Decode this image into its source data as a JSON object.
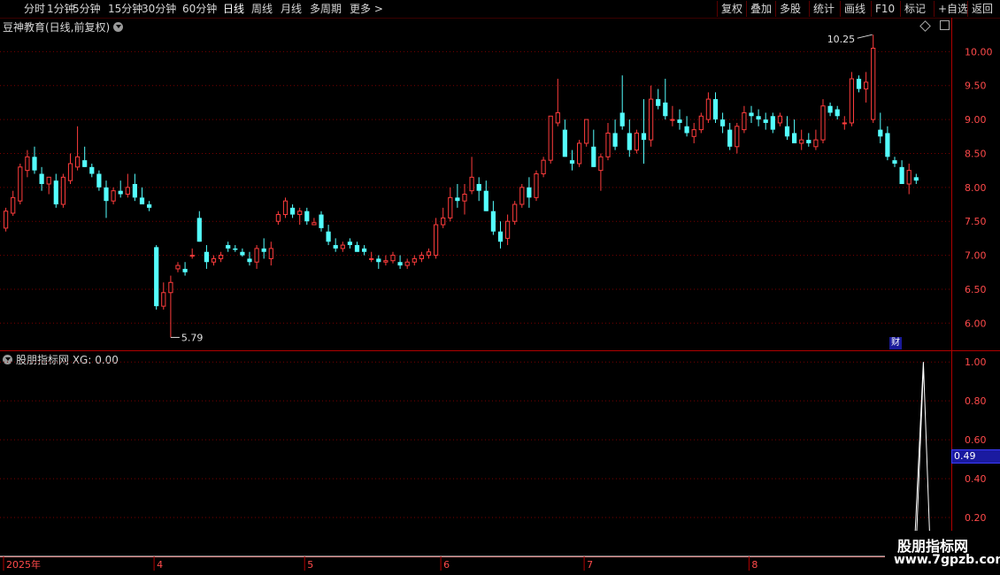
{
  "toolbar": {
    "left": [
      {
        "label": "分时"
      },
      {
        "label": "1分钟"
      },
      {
        "label": "5分钟"
      },
      {
        "label": "15分钟"
      },
      {
        "label": "30分钟"
      },
      {
        "label": "60分钟"
      },
      {
        "label": "日线",
        "active": true
      },
      {
        "label": "周线"
      },
      {
        "label": "月线"
      },
      {
        "label": "多周期"
      },
      {
        "label": "更多 >"
      }
    ],
    "right": [
      {
        "label": "复权"
      },
      {
        "label": "叠加"
      },
      {
        "label": "多股"
      },
      {
        "label": "统计"
      },
      {
        "label": "画线"
      },
      {
        "label": "F10"
      },
      {
        "label": "标记"
      },
      {
        "label": "+自选"
      },
      {
        "label": "返回"
      }
    ]
  },
  "main_title": "豆神教育(日线,前复权)",
  "indicator_title": "股朋指标网 XG: 0.00",
  "cai_label": "财",
  "high_label": "10.25",
  "low_label": "5.79",
  "current_indicator_value": "0.49",
  "watermark": {
    "line1": "股朋指标网",
    "line2": "www.7gpzb.com"
  },
  "colors": {
    "up": "#ff3c3c",
    "down": "#54ffff",
    "grid": "#7a0000",
    "axis": "#ff4a4a",
    "bg": "#000000"
  },
  "chart_data": [
    {
      "type": "candlestick",
      "title": "豆神教育(日线,前复权)",
      "ylim": [
        5.6,
        10.5
      ],
      "y_ticks": [
        "10.00",
        "9.50",
        "9.00",
        "8.50",
        "8.00",
        "7.50",
        "7.00",
        "6.50",
        "6.00"
      ],
      "x_date_labels": [
        {
          "label": "2025年",
          "index": 0
        },
        {
          "label": "4",
          "index": 21
        },
        {
          "label": "5",
          "index": 42
        },
        {
          "label": "6",
          "index": 61
        },
        {
          "label": "7",
          "index": 81
        },
        {
          "label": "8",
          "index": 104
        }
      ],
      "ohlc": [
        [
          7.4,
          7.7,
          7.35,
          7.65
        ],
        [
          7.62,
          7.95,
          7.58,
          7.85
        ],
        [
          7.8,
          8.35,
          7.75,
          8.3
        ],
        [
          8.25,
          8.55,
          8.15,
          8.45
        ],
        [
          8.45,
          8.6,
          8.2,
          8.25
        ],
        [
          8.2,
          8.3,
          7.95,
          8.05
        ],
        [
          8.05,
          8.15,
          7.9,
          8.15
        ],
        [
          8.1,
          8.2,
          7.7,
          7.75
        ],
        [
          7.75,
          8.2,
          7.7,
          8.15
        ],
        [
          8.1,
          8.5,
          8.05,
          8.35
        ],
        [
          8.3,
          8.9,
          8.25,
          8.45
        ],
        [
          8.4,
          8.6,
          8.3,
          8.3
        ],
        [
          8.3,
          8.35,
          8.15,
          8.2
        ],
        [
          8.2,
          8.25,
          7.95,
          8.0
        ],
        [
          8.0,
          8.1,
          7.55,
          7.8
        ],
        [
          7.8,
          8.0,
          7.75,
          7.95
        ],
        [
          7.95,
          8.1,
          7.85,
          7.9
        ],
        [
          7.9,
          8.2,
          7.85,
          8.0
        ],
        [
          8.05,
          8.2,
          7.8,
          7.85
        ],
        [
          7.85,
          8.0,
          7.75,
          7.75
        ],
        [
          7.75,
          7.8,
          7.65,
          7.7
        ],
        [
          7.12,
          7.15,
          6.2,
          6.25
        ],
        [
          6.25,
          6.6,
          6.2,
          6.45
        ],
        [
          6.45,
          6.7,
          5.79,
          6.6
        ],
        [
          6.8,
          6.9,
          6.75,
          6.85
        ],
        [
          6.8,
          6.9,
          6.7,
          6.75
        ],
        [
          7.0,
          7.1,
          6.95,
          7.0
        ],
        [
          7.55,
          7.65,
          7.2,
          7.2
        ],
        [
          7.05,
          7.15,
          6.8,
          6.9
        ],
        [
          6.9,
          7.0,
          6.85,
          6.95
        ],
        [
          6.95,
          7.05,
          6.9,
          7.0
        ],
        [
          7.15,
          7.2,
          7.05,
          7.1
        ],
        [
          7.1,
          7.15,
          7.05,
          7.08
        ],
        [
          7.05,
          7.1,
          6.98,
          7.0
        ],
        [
          6.95,
          7.05,
          6.85,
          6.9
        ],
        [
          6.9,
          7.15,
          6.8,
          7.1
        ],
        [
          7.1,
          7.25,
          6.95,
          7.05
        ],
        [
          6.95,
          7.2,
          6.85,
          7.1
        ],
        [
          7.5,
          7.65,
          7.45,
          7.6
        ],
        [
          7.6,
          7.85,
          7.55,
          7.8
        ],
        [
          7.7,
          7.75,
          7.55,
          7.6
        ],
        [
          7.6,
          7.7,
          7.45,
          7.65
        ],
        [
          7.65,
          7.7,
          7.45,
          7.5
        ],
        [
          7.45,
          7.55,
          7.45,
          7.48
        ],
        [
          7.6,
          7.65,
          7.35,
          7.4
        ],
        [
          7.35,
          7.45,
          7.15,
          7.2
        ],
        [
          7.15,
          7.25,
          7.05,
          7.1
        ],
        [
          7.1,
          7.2,
          7.05,
          7.15
        ],
        [
          7.2,
          7.25,
          7.1,
          7.15
        ],
        [
          7.15,
          7.2,
          7.05,
          7.05
        ],
        [
          7.1,
          7.15,
          7.0,
          7.05
        ],
        [
          6.95,
          7.05,
          6.9,
          6.95
        ],
        [
          6.95,
          7.0,
          6.8,
          6.9
        ],
        [
          6.9,
          7.0,
          6.85,
          6.92
        ],
        [
          6.92,
          7.05,
          6.88,
          7.0
        ],
        [
          6.9,
          7.0,
          6.8,
          6.85
        ],
        [
          6.85,
          6.95,
          6.8,
          6.9
        ],
        [
          6.9,
          7.0,
          6.85,
          6.95
        ],
        [
          6.95,
          7.05,
          6.9,
          7.0
        ],
        [
          7.0,
          7.1,
          6.95,
          7.05
        ],
        [
          7.0,
          7.55,
          6.95,
          7.45
        ],
        [
          7.45,
          7.7,
          7.4,
          7.55
        ],
        [
          7.55,
          8.0,
          7.5,
          7.85
        ],
        [
          7.85,
          8.05,
          7.7,
          7.8
        ],
        [
          7.8,
          8.05,
          7.6,
          7.9
        ],
        [
          7.95,
          8.45,
          7.9,
          8.15
        ],
        [
          8.05,
          8.15,
          7.8,
          7.95
        ],
        [
          7.95,
          8.1,
          7.65,
          7.65
        ],
        [
          7.65,
          7.8,
          7.3,
          7.35
        ],
        [
          7.35,
          7.5,
          7.1,
          7.2
        ],
        [
          7.25,
          7.6,
          7.15,
          7.5
        ],
        [
          7.5,
          7.8,
          7.45,
          7.75
        ],
        [
          7.75,
          8.05,
          7.7,
          8.0
        ],
        [
          8.0,
          8.15,
          7.7,
          7.85
        ],
        [
          7.85,
          8.25,
          7.8,
          8.2
        ],
        [
          8.2,
          8.45,
          8.15,
          8.4
        ],
        [
          8.4,
          8.95,
          8.35,
          9.05
        ],
        [
          8.95,
          9.6,
          8.9,
          9.1
        ],
        [
          8.85,
          9.0,
          8.45,
          8.45
        ],
        [
          8.4,
          8.55,
          8.25,
          8.35
        ],
        [
          8.35,
          8.7,
          8.3,
          8.65
        ],
        [
          8.65,
          9.0,
          8.6,
          9.0
        ],
        [
          8.6,
          8.85,
          8.3,
          8.3
        ],
        [
          8.25,
          8.5,
          7.95,
          8.45
        ],
        [
          8.45,
          8.95,
          8.4,
          8.8
        ],
        [
          8.8,
          9.0,
          8.55,
          8.6
        ],
        [
          9.1,
          9.65,
          8.85,
          8.9
        ],
        [
          8.8,
          9.0,
          8.45,
          8.55
        ],
        [
          8.55,
          8.85,
          8.5,
          8.8
        ],
        [
          8.8,
          9.3,
          8.35,
          8.7
        ],
        [
          8.7,
          9.5,
          8.6,
          9.3
        ],
        [
          9.3,
          9.45,
          9.15,
          9.2
        ],
        [
          9.25,
          9.6,
          9.0,
          9.05
        ],
        [
          9.0,
          9.2,
          8.9,
          9.0
        ],
        [
          9.0,
          9.15,
          8.85,
          8.95
        ],
        [
          8.9,
          9.05,
          8.75,
          8.8
        ],
        [
          8.75,
          8.95,
          8.65,
          8.85
        ],
        [
          8.85,
          9.1,
          8.8,
          9.05
        ],
        [
          9.0,
          9.4,
          8.95,
          9.3
        ],
        [
          9.3,
          9.4,
          8.95,
          9.0
        ],
        [
          9.0,
          9.1,
          8.8,
          8.9
        ],
        [
          8.85,
          8.95,
          8.55,
          8.6
        ],
        [
          8.6,
          8.95,
          8.5,
          8.9
        ],
        [
          8.85,
          9.2,
          8.8,
          9.1
        ],
        [
          9.1,
          9.2,
          8.95,
          9.05
        ],
        [
          9.05,
          9.15,
          8.9,
          9.0
        ],
        [
          9.0,
          9.1,
          8.85,
          8.95
        ],
        [
          9.05,
          9.1,
          8.8,
          8.85
        ],
        [
          8.95,
          9.1,
          8.9,
          9.05
        ],
        [
          8.9,
          9.05,
          8.7,
          8.75
        ],
        [
          8.8,
          9.0,
          8.65,
          8.65
        ],
        [
          8.65,
          8.85,
          8.55,
          8.7
        ],
        [
          8.7,
          8.8,
          8.6,
          8.65
        ],
        [
          8.6,
          8.85,
          8.55,
          8.7
        ],
        [
          8.7,
          9.3,
          8.65,
          9.2
        ],
        [
          9.2,
          9.25,
          9.05,
          9.1
        ],
        [
          9.15,
          9.2,
          9.0,
          9.05
        ],
        [
          8.95,
          9.05,
          8.85,
          8.95
        ],
        [
          8.95,
          9.7,
          8.9,
          9.6
        ],
        [
          9.6,
          9.65,
          9.4,
          9.45
        ],
        [
          9.45,
          9.7,
          9.25,
          9.55
        ],
        [
          9.0,
          10.25,
          8.95,
          10.05
        ],
        [
          8.85,
          9.1,
          8.65,
          8.75
        ],
        [
          8.8,
          8.9,
          8.4,
          8.45
        ],
        [
          8.4,
          8.45,
          8.3,
          8.35
        ],
        [
          8.3,
          8.4,
          8.05,
          8.05
        ],
        [
          8.05,
          8.35,
          7.9,
          8.25
        ],
        [
          8.15,
          8.2,
          8.05,
          8.1
        ]
      ]
    },
    {
      "type": "line",
      "title": "股朋指标网 XG: 0.00",
      "ylim": [
        0,
        1.06
      ],
      "y_ticks": [
        "1.00",
        "0.80",
        "0.60",
        "0.40",
        "0.20"
      ],
      "spike": {
        "index": 128,
        "value": 1.0
      },
      "current_value": 0.49
    }
  ]
}
